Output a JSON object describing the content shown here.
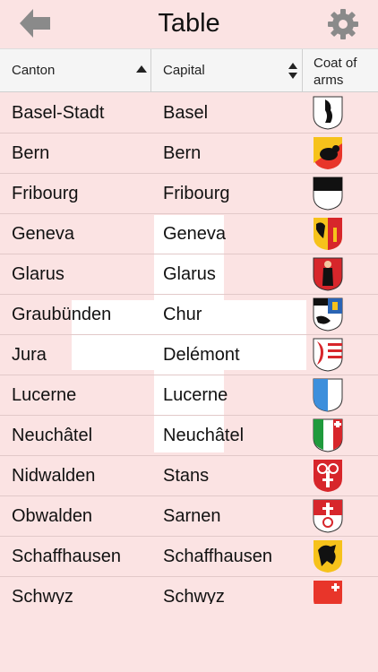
{
  "header": {
    "title": "Table",
    "back_icon": "back-arrow-icon",
    "settings_icon": "gear-icon"
  },
  "columns": {
    "canton": "Canton",
    "capital": "Capital",
    "coat_line1": "Coat of",
    "coat_line2": "arms"
  },
  "rows": [
    {
      "canton": "Basel-Stadt",
      "capital": "Basel",
      "coat_icon": "basel-stadt-coat-of-arms-icon"
    },
    {
      "canton": "Bern",
      "capital": "Bern",
      "coat_icon": "bern-coat-of-arms-icon"
    },
    {
      "canton": "Fribourg",
      "capital": "Fribourg",
      "coat_icon": "fribourg-coat-of-arms-icon"
    },
    {
      "canton": "Geneva",
      "capital": "Geneva",
      "coat_icon": "geneva-coat-of-arms-icon"
    },
    {
      "canton": "Glarus",
      "capital": "Glarus",
      "coat_icon": "glarus-coat-of-arms-icon"
    },
    {
      "canton": "Graubünden",
      "capital": "Chur",
      "coat_icon": "graubunden-coat-of-arms-icon"
    },
    {
      "canton": "Jura",
      "capital": "Delémont",
      "coat_icon": "jura-coat-of-arms-icon"
    },
    {
      "canton": "Lucerne",
      "capital": "Lucerne",
      "coat_icon": "lucerne-coat-of-arms-icon"
    },
    {
      "canton": "Neuchâtel",
      "capital": "Neuchâtel",
      "coat_icon": "neuchatel-coat-of-arms-icon"
    },
    {
      "canton": "Nidwalden",
      "capital": "Stans",
      "coat_icon": "nidwalden-coat-of-arms-icon"
    },
    {
      "canton": "Obwalden",
      "capital": "Sarnen",
      "coat_icon": "obwalden-coat-of-arms-icon"
    },
    {
      "canton": "Schaffhausen",
      "capital": "Schaffhausen",
      "coat_icon": "schaffhausen-coat-of-arms-icon"
    },
    {
      "canton": "Schwyz",
      "capital": "Schwyz",
      "coat_icon": "schwyz-coat-of-arms-icon"
    }
  ],
  "colors": {
    "background": "#fbe3e3",
    "header_bar": "#f5f5f5",
    "icon_gray": "#8a8a8a"
  }
}
